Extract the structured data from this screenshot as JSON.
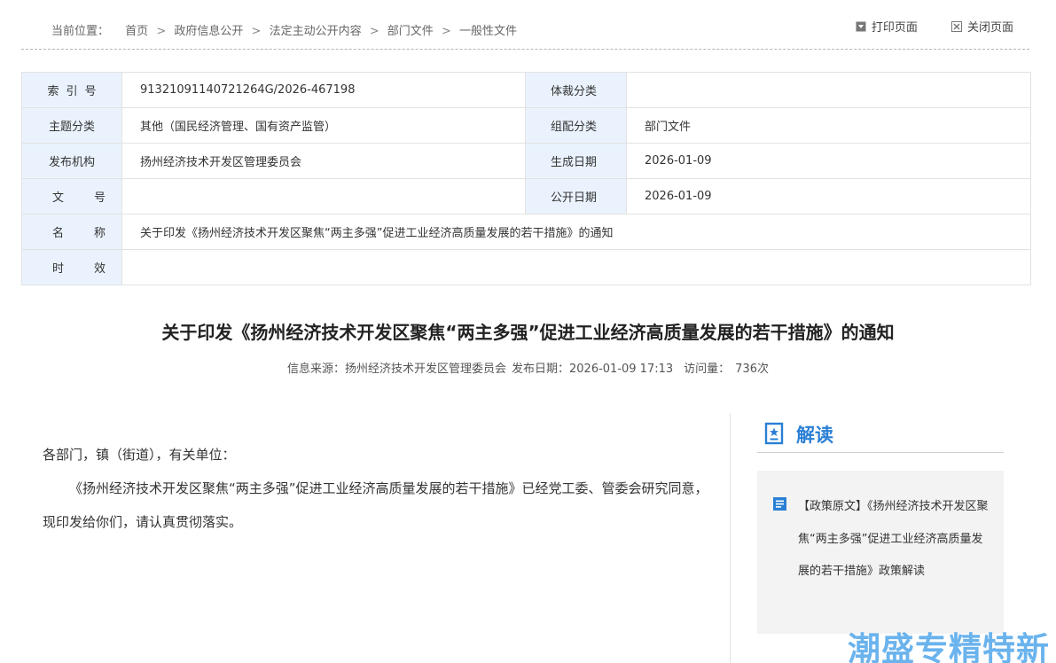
{
  "breadcrumb": {
    "label": "当前位置：",
    "items": [
      "首页",
      "政府信息公开",
      "法定主动公开内容",
      "部门文件",
      "一般性文件"
    ],
    "separator": ">"
  },
  "tools": {
    "print": "打印页面",
    "close": "关闭页面"
  },
  "meta": {
    "index_label": "索引号",
    "index_value": "91321091140721264G/2026-467198",
    "genre_label": "体裁分类",
    "genre_value": "",
    "topic_label": "主题分类",
    "topic_value": "其他（国民经济管理、国有资产监管）",
    "combo_label": "组配分类",
    "combo_value": "部门文件",
    "publisher_label": "发布机构",
    "publisher_value": "扬州经济技术开发区管理委员会",
    "created_label": "生成日期",
    "created_value": "2026-01-09",
    "docno_label": "文号",
    "docno_value": "",
    "public_label": "公开日期",
    "public_value": "2026-01-09",
    "name_label": "名称",
    "name_value": "关于印发《扬州经济技术开发区聚焦“两主多强”促进工业经济高质量发展的若干措施》的通知",
    "validity_label": "时效",
    "validity_value": ""
  },
  "document": {
    "title": "关于印发《扬州经济技术开发区聚焦“两主多强”促进工业经济高质量发展的若干措施》的通知",
    "source": "信息来源：扬州经济技术开发区管理委员会",
    "publish": "发布日期：2026-01-09 17:13",
    "visits_label": "访问量：",
    "visits_value": "736次",
    "greeting": "各部门，镇（街道），有关单位：",
    "paragraph": "《扬州经济技术开发区聚焦“两主多强”促进工业经济高质量发展的若干措施》已经党工委、管委会研究同意，现印发给你们，请认真贯彻落实。"
  },
  "interpretation": {
    "heading": "解读",
    "link_text": "【政策原文】《扬州经济技术开发区聚焦“两主多强”促进工业经济高质量发展的若干措施》政策解读"
  },
  "watermark": "潮盛专精特新",
  "colors": {
    "accent": "#2a7fd4",
    "label_bg": "#eaf3fd",
    "watermark": "#4aa3ea"
  },
  "icons": {
    "print": "print-icon",
    "close": "close-box-icon",
    "heading": "document-star-icon",
    "list": "list-doc-icon"
  }
}
